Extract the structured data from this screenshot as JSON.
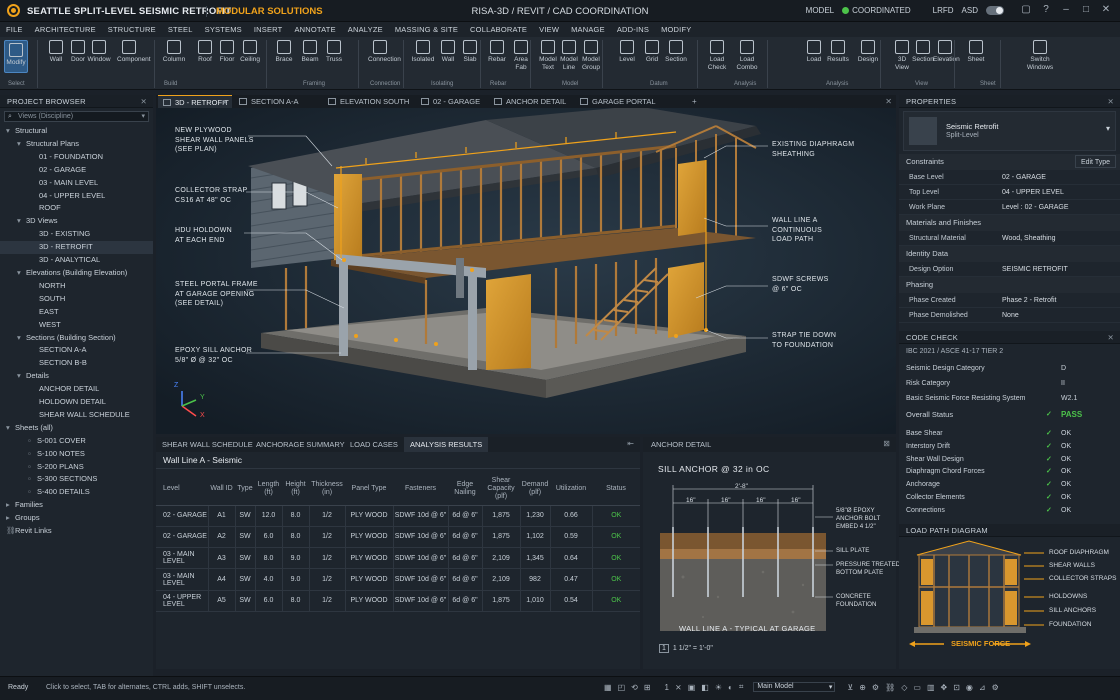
{
  "titlebar": {
    "app_title": "SEATTLE SPLIT-LEVEL SEISMIC RETROFIT",
    "app_subtitle": "MODULAR SOLUTIONS",
    "center_title": "RISA-3D / REVIT / CAD COORDINATION",
    "model_label": "MODEL",
    "model_status": "COORDINATED",
    "status_color": "#4cc34a",
    "lrfd": "LRFD",
    "asd": "ASD"
  },
  "menu": [
    "FILE",
    "ARCHITECTURE",
    "STRUCTURE",
    "STEEL",
    "SYSTEMS",
    "INSERT",
    "ANNOTATE",
    "ANALYZE",
    "MASSING & SITE",
    "COLLABORATE",
    "VIEW",
    "MANAGE",
    "ADD-INS",
    "MODIFY"
  ],
  "ribbon": {
    "buttons": [
      {
        "label": "Modify",
        "icon": "cursor-icon"
      },
      {
        "label": "Wall",
        "icon": "wall-icon"
      },
      {
        "label": "Door",
        "icon": "door-icon"
      },
      {
        "label": "Window",
        "icon": "window-icon"
      },
      {
        "label": "Component",
        "icon": "component-icon"
      },
      {
        "label": "Column",
        "icon": "column-icon"
      },
      {
        "label": "Roof",
        "icon": "roof-icon"
      },
      {
        "label": "Floor",
        "icon": "floor-icon"
      },
      {
        "label": "Ceiling",
        "icon": "ceiling-icon"
      },
      {
        "label": "Brace",
        "icon": "brace-icon"
      },
      {
        "label": "Beam",
        "icon": "beam-icon"
      },
      {
        "label": "Truss",
        "icon": "truss-icon"
      },
      {
        "label": "Connection",
        "icon": "connection-icon"
      },
      {
        "label": "Isolated",
        "icon": "isolated-footing-icon"
      },
      {
        "label": "Wall",
        "icon": "wall-footing-icon"
      },
      {
        "label": "Slab",
        "icon": "slab-icon"
      },
      {
        "label": "Rebar",
        "icon": "rebar-icon"
      },
      {
        "label": "Area Fab",
        "icon": "area-fabric-icon"
      },
      {
        "label": "Model Text",
        "icon": "model-text-icon"
      },
      {
        "label": "Model Line",
        "icon": "model-line-icon"
      },
      {
        "label": "Model Group",
        "icon": "model-group-icon"
      },
      {
        "label": "Level",
        "icon": "level-icon"
      },
      {
        "label": "Grid",
        "icon": "grid-icon"
      },
      {
        "label": "Section",
        "icon": "section-icon"
      },
      {
        "label": "Load Check",
        "icon": "load-check-icon"
      },
      {
        "label": "Load Combo",
        "icon": "load-combo-icon"
      },
      {
        "label": "Load",
        "icon": "load-icon"
      },
      {
        "label": "Results",
        "icon": "results-icon"
      },
      {
        "label": "Design",
        "icon": "design-icon"
      },
      {
        "label": "3D View",
        "icon": "3d-view-icon"
      },
      {
        "label": "Section",
        "icon": "section-view-icon"
      },
      {
        "label": "Elevation",
        "icon": "elevation-icon"
      },
      {
        "label": "Sheet",
        "icon": "sheet-icon"
      },
      {
        "label": "Switch Windows",
        "icon": "switch-windows-icon"
      }
    ],
    "groups": [
      "Select",
      "Build",
      "Framing",
      "Connection",
      "Isolating",
      "Rebar",
      "Model",
      "Datum",
      "Analysis",
      "Analysis",
      "View",
      "Sheet"
    ]
  },
  "browser": {
    "title": "PROJECT BROWSER",
    "search_placeholder": "Views (Discipline)",
    "tree": [
      {
        "label": "Structural",
        "depth": 0,
        "arrow": "▾"
      },
      {
        "label": "Structural Plans",
        "depth": 1,
        "arrow": "▾"
      },
      {
        "label": "01 - FOUNDATION",
        "depth": 3
      },
      {
        "label": "02 - GARAGE",
        "depth": 3
      },
      {
        "label": "03 - MAIN LEVEL",
        "depth": 3
      },
      {
        "label": "04 - UPPER LEVEL",
        "depth": 3
      },
      {
        "label": "ROOF",
        "depth": 3
      },
      {
        "label": "3D Views",
        "depth": 1,
        "arrow": "▾"
      },
      {
        "label": "3D - EXISTING",
        "depth": 3
      },
      {
        "label": "3D - RETROFIT",
        "depth": 3,
        "selected": true
      },
      {
        "label": "3D - ANALYTICAL",
        "depth": 3
      },
      {
        "label": "Elevations (Building Elevation)",
        "depth": 1,
        "arrow": "▾"
      },
      {
        "label": "NORTH",
        "depth": 3
      },
      {
        "label": "SOUTH",
        "depth": 3
      },
      {
        "label": "EAST",
        "depth": 3
      },
      {
        "label": "WEST",
        "depth": 3
      },
      {
        "label": "Sections (Building Section)",
        "depth": 1,
        "arrow": "▾"
      },
      {
        "label": "SECTION A-A",
        "depth": 3
      },
      {
        "label": "SECTION B-B",
        "depth": 3
      },
      {
        "label": "Details",
        "depth": 1,
        "arrow": "▾"
      },
      {
        "label": "ANCHOR DETAIL",
        "depth": 3
      },
      {
        "label": "HOLDOWN DETAIL",
        "depth": 3
      },
      {
        "label": "SHEAR WALL SCHEDULE",
        "depth": 3
      },
      {
        "label": "Sheets (all)",
        "depth": 0,
        "arrow": "▾"
      },
      {
        "label": "S-001  COVER",
        "depth": 2
      },
      {
        "label": "S-100  NOTES",
        "depth": 2
      },
      {
        "label": "S-200  PLANS",
        "depth": 2
      },
      {
        "label": "S-300  SECTIONS",
        "depth": 2
      },
      {
        "label": "S-400  DETAILS",
        "depth": 2
      },
      {
        "label": "Families",
        "depth": 0,
        "arrow": "▸"
      },
      {
        "label": "Groups",
        "depth": 0,
        "arrow": "▸"
      },
      {
        "label": "Revit Links",
        "depth": 0
      }
    ]
  },
  "view_tabs": [
    "3D - RETROFIT",
    "SECTION A-A",
    "ELEVATION SOUTH",
    "02 - GARAGE",
    "ANCHOR DETAIL",
    "GARAGE PORTAL FRAME"
  ],
  "callouts_left": [
    "NEW PLYWOOD\nSHEAR WALL PANELS\n(SEE PLAN)",
    "COLLECTOR STRAP\nCS16 AT 48\" OC",
    "HDU HOLDOWN\nAT EACH END",
    "STEEL PORTAL FRAME\nAT GARAGE OPENING\n(SEE DETAIL)",
    "EPOXY SILL ANCHOR\n5/8\" Ø @ 32\" OC"
  ],
  "callouts_right": [
    "EXISTING DIAPHRAGM\nSHEATHING",
    "WALL LINE A\nCONTINUOUS\nLOAD PATH",
    "SDWF SCREWS\n@ 6\" OC",
    "STRAP TIE DOWN\nTO FOUNDATION"
  ],
  "axis": {
    "x": "X",
    "y": "Y",
    "z": "Z"
  },
  "bottom_tabs": [
    "SHEAR WALL SCHEDULE",
    "ANCHORAGE SUMMARY",
    "LOAD CASES",
    "ANALYSIS RESULTS"
  ],
  "schedule": {
    "title": "Wall Line A - Seismic",
    "headers": [
      "Level",
      "Wall ID",
      "Type",
      "Length\n(ft)",
      "Height\n(ft)",
      "Thickness\n(in)",
      "Panel Type",
      "Fasteners",
      "Edge\nNailing",
      "Shear\nCapacity (plf)",
      "Demand\n(plf)",
      "Utilization",
      "Status"
    ],
    "rows": [
      [
        "02 - GARAGE",
        "A1",
        "SW",
        "12.0",
        "8.0",
        "1/2",
        "PLY WOOD",
        "SDWF 10d @ 6\"",
        "6d @ 6\"",
        "1,875",
        "1,230",
        "0.66",
        "OK"
      ],
      [
        "02 - GARAGE",
        "A2",
        "SW",
        "6.0",
        "8.0",
        "1/2",
        "PLY WOOD",
        "SDWF 10d @ 6\"",
        "6d @ 6\"",
        "1,875",
        "1,102",
        "0.59",
        "OK"
      ],
      [
        "03 - MAIN LEVEL",
        "A3",
        "SW",
        "8.0",
        "9.0",
        "1/2",
        "PLY WOOD",
        "SDWF 10d @ 6\"",
        "6d @ 6\"",
        "2,109",
        "1,345",
        "0.64",
        "OK"
      ],
      [
        "03 - MAIN LEVEL",
        "A4",
        "SW",
        "4.0",
        "9.0",
        "1/2",
        "PLY WOOD",
        "SDWF 10d @ 6\"",
        "6d @ 6\"",
        "2,109",
        "982",
        "0.47",
        "OK"
      ],
      [
        "04 - UPPER LEVEL",
        "A5",
        "SW",
        "6.0",
        "8.0",
        "1/2",
        "PLY WOOD",
        "SDWF 10d @ 6\"",
        "6d @ 6\"",
        "1,875",
        "1,010",
        "0.54",
        "OK"
      ]
    ]
  },
  "anchor_detail": {
    "tab": "ANCHOR DETAIL",
    "title": "SILL ANCHOR @ 32 in OC",
    "overall": "2'-8\"",
    "spacing": [
      "16\"",
      "16\"",
      "16\"",
      "16\""
    ],
    "labels": [
      "5/8\"Ø EPOXY\nANCHOR BOLT\nEMBED 4 1/2\"",
      "SILL PLATE",
      "PRESSURE TREATED\nBOTTOM PLATE",
      "CONCRETE\nFOUNDATION"
    ],
    "caption": "WALL LINE A - TYPICAL AT GARAGE",
    "scale": "1 1/2\" = 1'-0\""
  },
  "properties": {
    "title": "PROPERTIES",
    "type_name": "Seismic Retrofit",
    "type_sub": "Split-Level",
    "edit_type": "Edit Type",
    "sections": [
      {
        "name": "Constraints",
        "rows": [
          [
            "Base Level",
            "02 - GARAGE"
          ],
          [
            "Top Level",
            "04 - UPPER LEVEL"
          ],
          [
            "Work Plane",
            "Level : 02 - GARAGE"
          ]
        ]
      },
      {
        "name": "Materials and Finishes",
        "rows": [
          [
            "Structural Material",
            "Wood, Sheathing"
          ]
        ]
      },
      {
        "name": "Identity Data",
        "rows": [
          [
            "Design Option",
            "SEISMIC RETROFIT"
          ]
        ]
      },
      {
        "name": "Phasing",
        "rows": [
          [
            "Phase Created",
            "Phase 2 - Retrofit"
          ],
          [
            "Phase Demolished",
            "None"
          ]
        ]
      }
    ]
  },
  "code_check": {
    "title": "CODE CHECK",
    "code": "IBC 2021 / ASCE 41-17 TIER 2",
    "params": [
      [
        "Seismic Design Category",
        "D"
      ],
      [
        "Risk Category",
        "II"
      ],
      [
        "Basic Seismic Force Resisting System",
        "W2.1"
      ]
    ],
    "overall_label": "Overall Status",
    "overall_value": "PASS",
    "checks": [
      [
        "Base Shear",
        "OK"
      ],
      [
        "Interstory Drift",
        "OK"
      ],
      [
        "Shear Wall Design",
        "OK"
      ],
      [
        "Diaphragm Chord Forces",
        "OK"
      ],
      [
        "Anchorage",
        "OK"
      ],
      [
        "Collector Elements",
        "OK"
      ],
      [
        "Connections",
        "OK"
      ]
    ]
  },
  "load_path": {
    "title": "LOAD PATH DIAGRAM",
    "labels": [
      "ROOF DIAPHRAGM",
      "SHEAR WALLS",
      "COLLECTOR STRAPS",
      "HOLDOWNS",
      "SILL ANCHORS",
      "FOUNDATION"
    ],
    "force": "SEISMIC FORCE"
  },
  "status": {
    "ready": "Ready",
    "hint": "Click to select, TAB for alternates, CTRL adds, SHIFT unselects.",
    "scale": "1",
    "model": "Main Model"
  }
}
